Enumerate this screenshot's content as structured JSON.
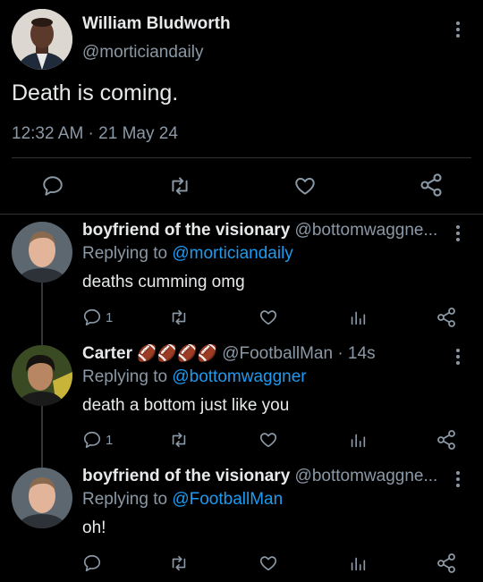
{
  "main_tweet": {
    "author_name": "William Bludworth",
    "author_handle": "@morticiandaily",
    "text": "Death is coming.",
    "timestamp": "12:32 AM · 21 May 24"
  },
  "replies": [
    {
      "name": "boyfriend of the visionary",
      "handle": "@bottomwaggne...",
      "replying_prefix": "Replying to ",
      "replying_to": "@morticiandaily",
      "text": "deaths cumming omg",
      "reply_count": "1"
    },
    {
      "name": "Carter",
      "emojis": "🏈🏈🏈🏈",
      "handle": "@FootballMan",
      "time": "· 14s",
      "replying_prefix": "Replying to ",
      "replying_to": "@bottomwaggner",
      "text": "death a bottom just like you",
      "reply_count": "1"
    },
    {
      "name": "boyfriend of the visionary",
      "handle": "@bottomwaggne...",
      "replying_prefix": "Replying to ",
      "replying_to": "@FootballMan",
      "text": "oh!",
      "reply_count": ""
    }
  ],
  "colors": {
    "background": "#000000",
    "text": "#e7e9ea",
    "secondary": "#8b98a5",
    "link": "#1d9bf0",
    "divider": "#2f3336"
  }
}
